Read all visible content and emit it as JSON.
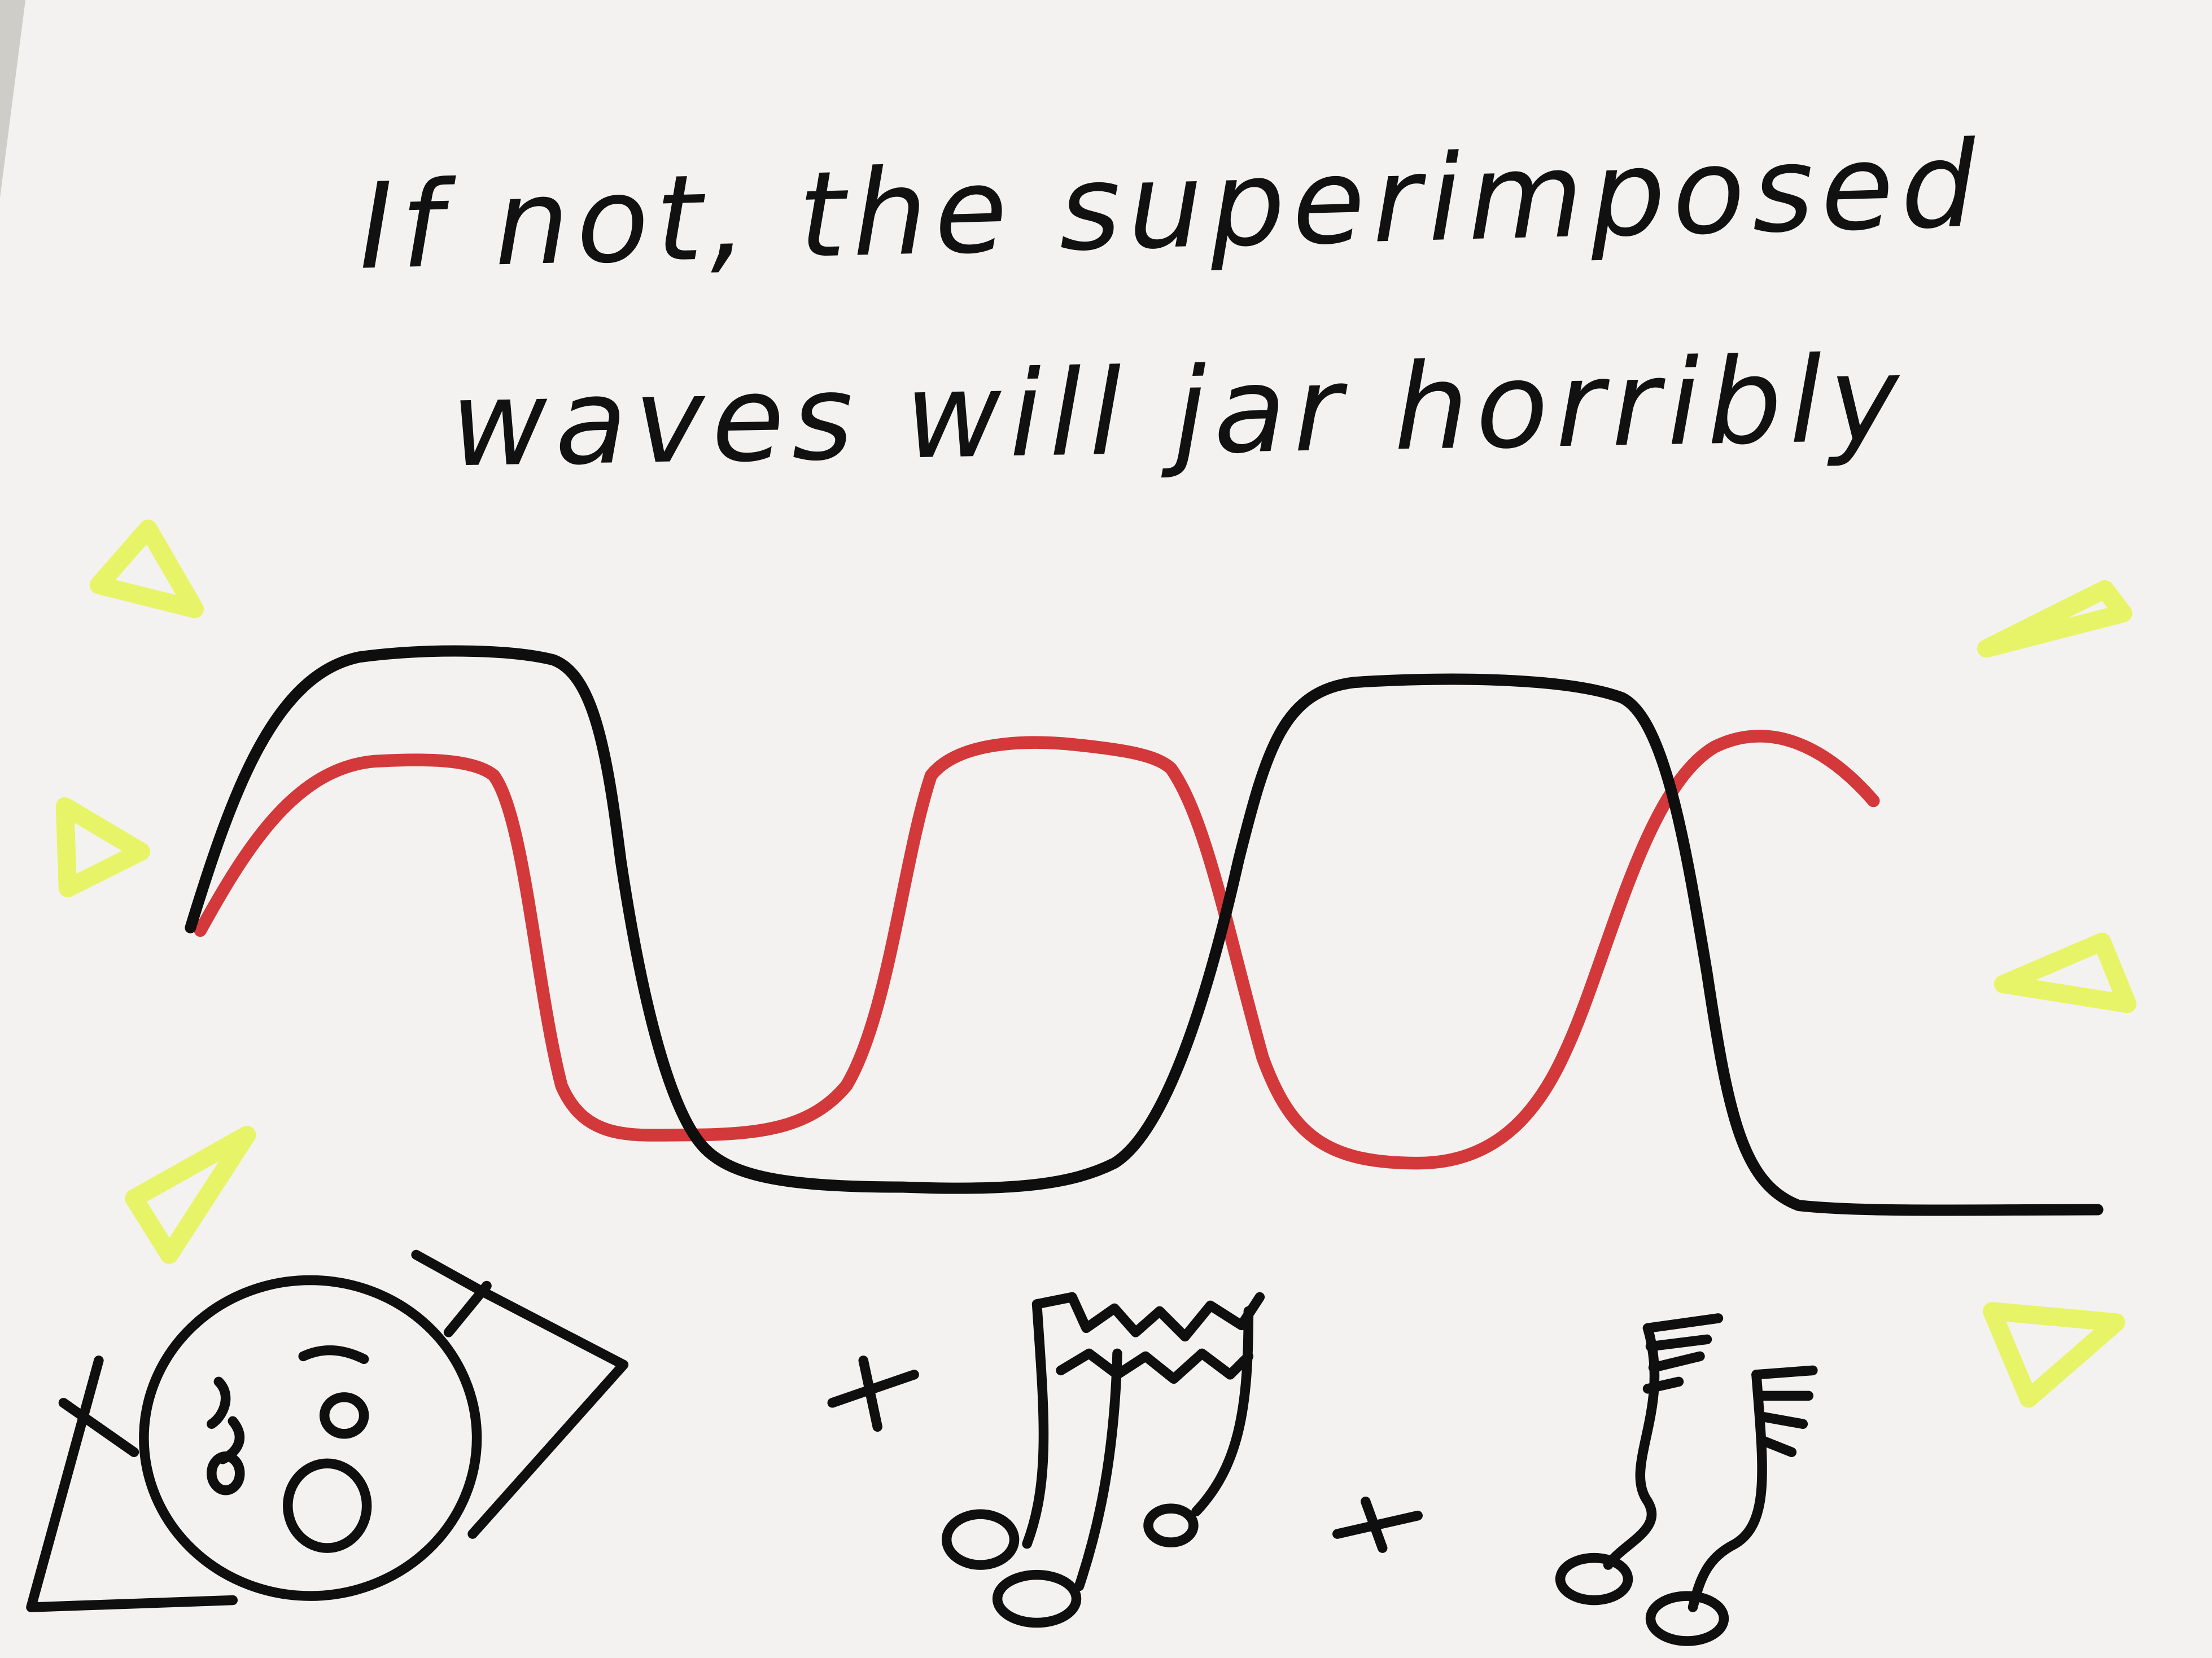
{
  "photo": {
    "description_free": true,
    "caption": {
      "line1": "If not, the superimposed",
      "line2": "waves will jar horribly"
    },
    "colors": {
      "paper": "#f4f3f1",
      "ink": "#101010",
      "red_wave": "#d23a35",
      "highlighter": "#e6f25a"
    },
    "icons": [
      "distressed-face-icon",
      "music-notes-icon",
      "spiky-music-note-icon",
      "yellow-triangle-icon"
    ]
  }
}
